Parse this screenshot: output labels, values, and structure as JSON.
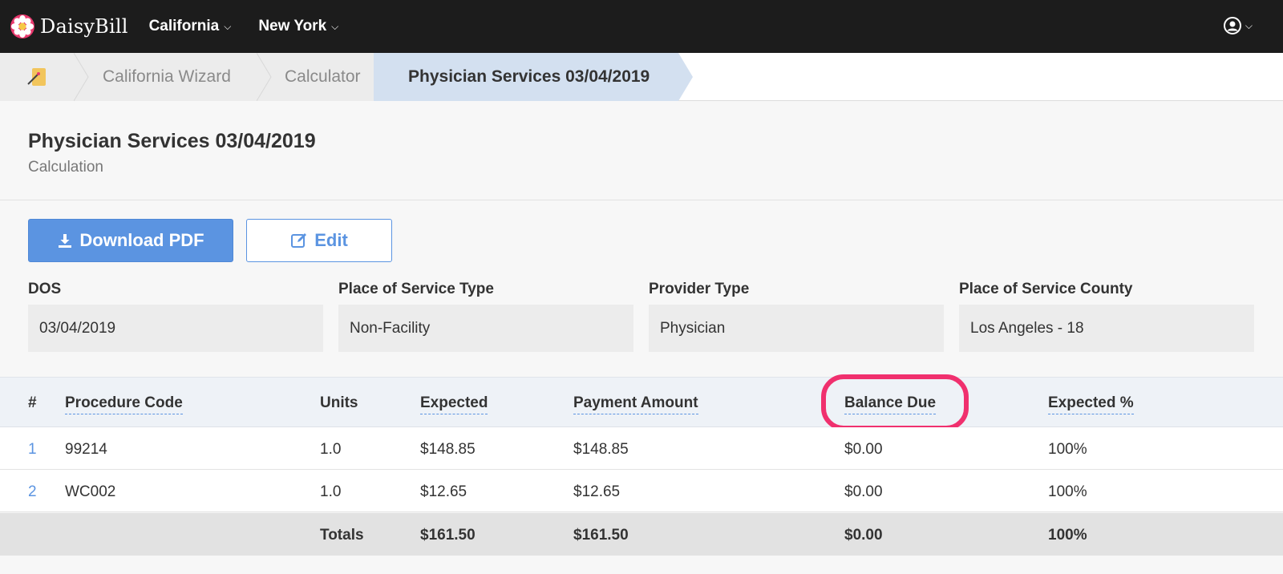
{
  "nav": {
    "brand": "DaisyBill",
    "menus": [
      {
        "label": "California"
      },
      {
        "label": "New York"
      }
    ]
  },
  "breadcrumb": {
    "items": [
      "California Wizard",
      "Calculator",
      "Physician Services 03/04/2019"
    ]
  },
  "page": {
    "title": "Physician Services 03/04/2019",
    "subtitle": "Calculation"
  },
  "actions": {
    "download_label": "Download PDF",
    "edit_label": "Edit"
  },
  "fields": [
    {
      "label": "DOS",
      "value": "03/04/2019"
    },
    {
      "label": "Place of Service Type",
      "value": "Non-Facility"
    },
    {
      "label": "Provider Type",
      "value": "Physician"
    },
    {
      "label": "Place of Service County",
      "value": "Los Angeles - 18"
    }
  ],
  "table": {
    "headers": [
      "#",
      "Procedure Code",
      "Units",
      "Expected",
      "Payment Amount",
      "Balance Due",
      "Expected %"
    ],
    "rows": [
      {
        "num": "1",
        "code": "99214",
        "units": "1.0",
        "expected": "$148.85",
        "payment": "$148.85",
        "balance": "$0.00",
        "pct": "100%"
      },
      {
        "num": "2",
        "code": "WC002",
        "units": "1.0",
        "expected": "$12.65",
        "payment": "$12.65",
        "balance": "$0.00",
        "pct": "100%"
      }
    ],
    "totals": {
      "label": "Totals",
      "expected": "$161.50",
      "payment": "$161.50",
      "balance": "$0.00",
      "pct": "100%"
    }
  },
  "colors": {
    "accent": "#5b94e1",
    "highlight": "#f0306e",
    "nav_bg": "#1c1c1c"
  }
}
